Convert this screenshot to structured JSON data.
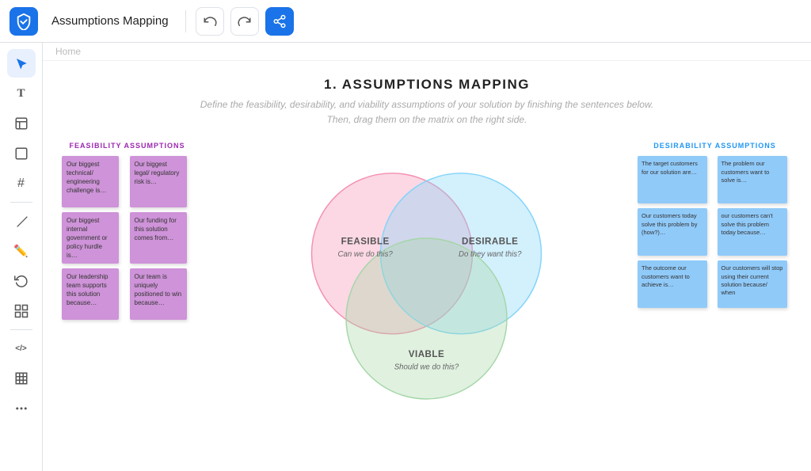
{
  "topbar": {
    "title": "Assumptions Mapping",
    "undo_label": "Undo",
    "redo_label": "Redo",
    "share_label": "Share"
  },
  "breadcrumb": "Home",
  "sidebar": {
    "tools": [
      {
        "name": "select",
        "icon": "↖",
        "active": true
      },
      {
        "name": "text",
        "icon": "T",
        "active": false
      },
      {
        "name": "sticky",
        "icon": "▭",
        "active": false
      },
      {
        "name": "frame",
        "icon": "▢",
        "active": false
      },
      {
        "name": "grid",
        "icon": "#",
        "active": false
      },
      {
        "name": "line",
        "icon": "/",
        "active": false
      },
      {
        "name": "draw",
        "icon": "✏",
        "active": false
      },
      {
        "name": "rotate",
        "icon": "↺",
        "active": false
      },
      {
        "name": "connect",
        "icon": "⊞",
        "active": false
      },
      {
        "name": "code",
        "icon": "</>",
        "active": false
      },
      {
        "name": "table",
        "icon": "⊟",
        "active": false
      },
      {
        "name": "more",
        "icon": "⊞",
        "active": false
      }
    ]
  },
  "page": {
    "title": "1. ASSUMPTIONS MAPPING",
    "subtitle_line1": "Define the feasibility, desirability, and viability assumptions of your solution by finishing the sentences below.",
    "subtitle_line2": "Then, drag them on the matrix on the right side."
  },
  "feasibility": {
    "section_label": "FEASIBILITY ASSUMPTIONS",
    "notes": [
      "Our biggest technical/ engineering challenge is…",
      "Our biggest legal/ regulatory risk is…",
      "Our biggest internal government or policy hurdle is…",
      "Our funding for this solution comes from…",
      "Our leadership team supports this solution because…",
      "Our team is uniquely positioned to win because…"
    ]
  },
  "desirability": {
    "section_label": "DESIRABILITY ASSUMPTIONS",
    "notes": [
      "The target customers for our solution are…",
      "The problem our customers want to solve is…",
      "Our customers today solve this problem by (how?)…",
      "our customers can't solve this problem today because…",
      "The outcome our customers want to achieve is…",
      "Our customers will stop using their current solution because/ when"
    ]
  },
  "venn": {
    "feasible_label": "FEASIBLE",
    "feasible_sub": "Can we do this?",
    "desirable_label": "DESIRABLE",
    "desirable_sub": "Do they want this?",
    "viable_label": "VIABLE",
    "viable_sub": "Should we do this?"
  }
}
